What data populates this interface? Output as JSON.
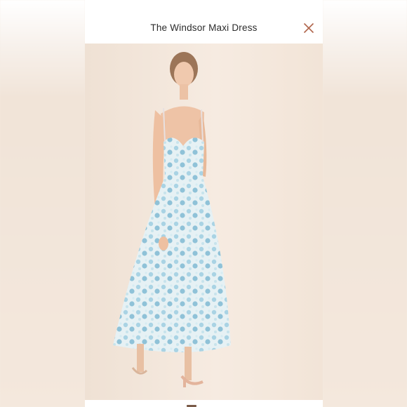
{
  "product": {
    "title": "The Windsor Maxi Dress"
  },
  "icons": {
    "close": "close-icon"
  },
  "colors": {
    "close_icon": "#b0664c",
    "background": "#f3e6da",
    "dress_blue": "#a9d3e4"
  }
}
